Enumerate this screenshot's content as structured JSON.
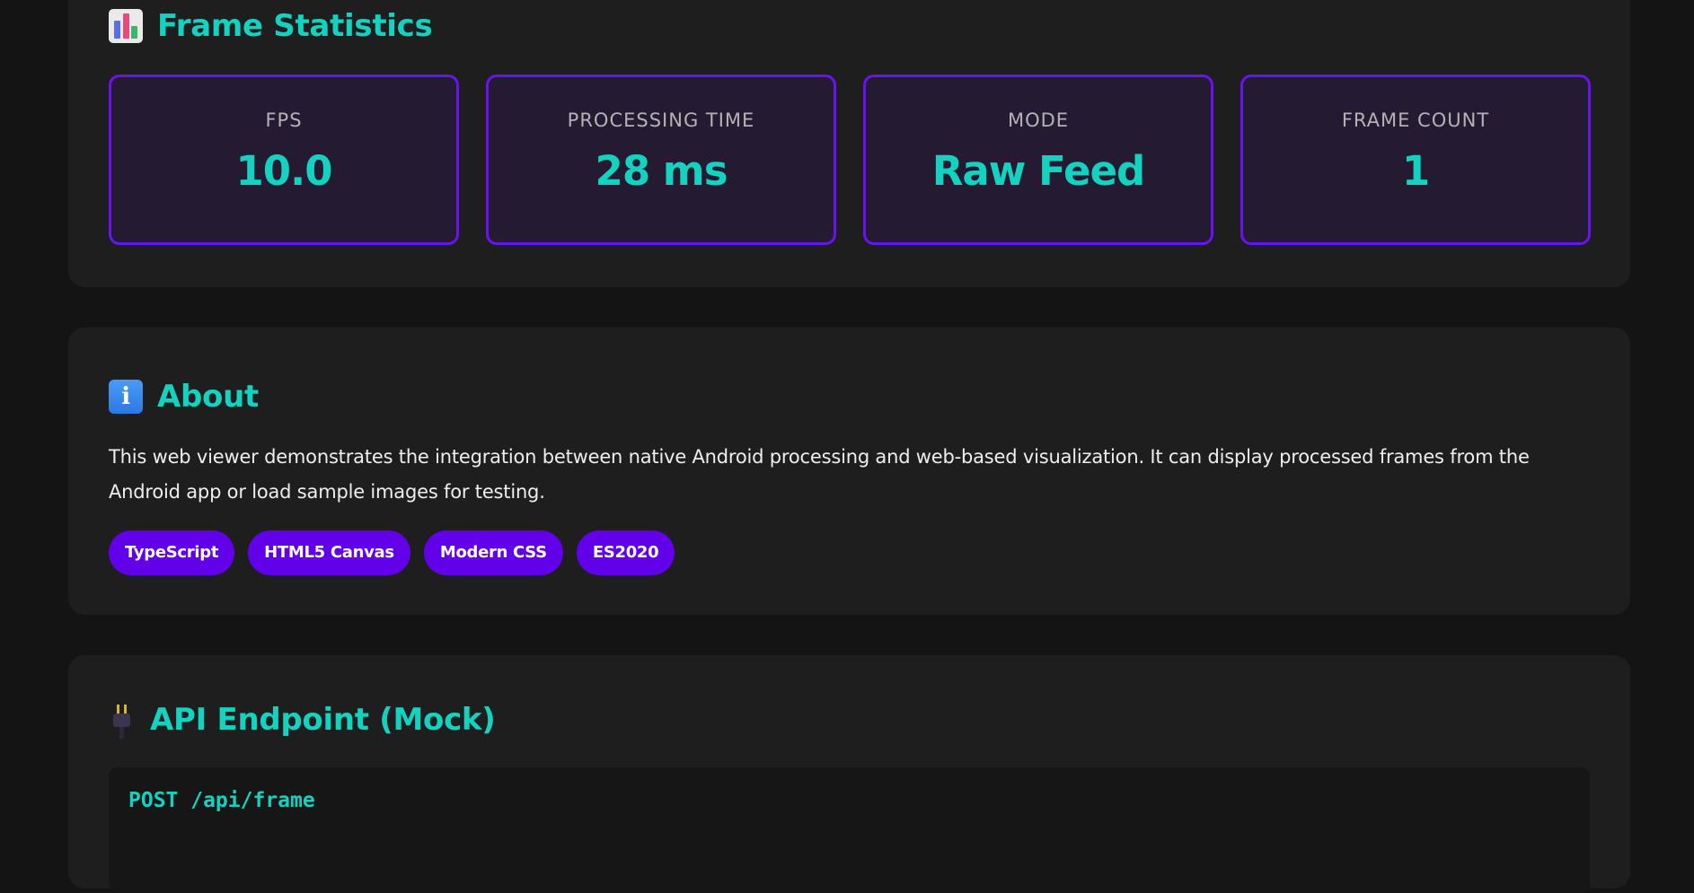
{
  "frame_statistics": {
    "title": "Frame Statistics",
    "icon": "bar-chart-icon",
    "stats": [
      {
        "label": "FPS",
        "value": "10.0"
      },
      {
        "label": "PROCESSING TIME",
        "value": "28 ms"
      },
      {
        "label": "MODE",
        "value": "Raw Feed"
      },
      {
        "label": "FRAME COUNT",
        "value": "1"
      }
    ]
  },
  "about": {
    "title": "About",
    "icon": "info-icon",
    "description": "This web viewer demonstrates the integration between native Android processing and web-based visualization. It can display processed frames from the Android app or load sample images for testing.",
    "tags": [
      "TypeScript",
      "HTML5 Canvas",
      "Modern CSS",
      "ES2020"
    ]
  },
  "api": {
    "title": "API Endpoint (Mock)",
    "icon": "plug-icon",
    "code_line": "POST /api/frame"
  },
  "colors": {
    "page_background": "#141414",
    "card_background": "#1e1e1e",
    "accent_teal": "#14d2bf",
    "accent_purple": "#6200ea",
    "stat_border": "#6a12f0"
  }
}
